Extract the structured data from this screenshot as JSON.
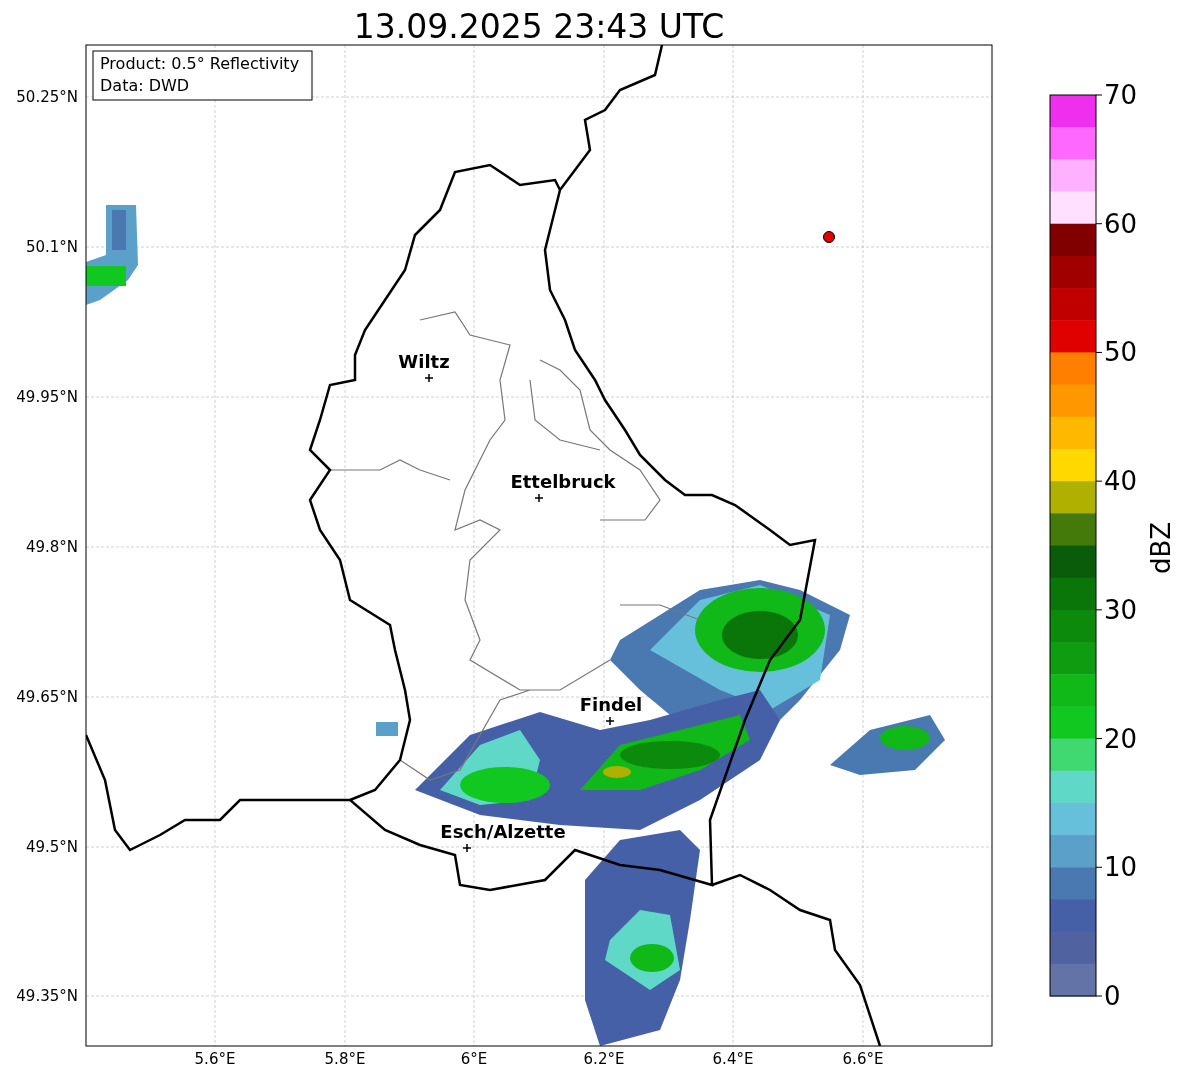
{
  "title": "13.09.2025 23:43 UTC",
  "legend": [
    "Product: 0.5° Reflectivity",
    "Data: DWD"
  ],
  "map": {
    "lat_labels": [
      "50.25°N",
      "50.1°N",
      "49.95°N",
      "49.8°N",
      "49.65°N",
      "49.5°N",
      "49.35°N"
    ],
    "lon_labels": [
      "5.6°E",
      "5.8°E",
      "6°E",
      "6.2°E",
      "6.4°E",
      "6.6°E"
    ],
    "places": [
      {
        "name": "Wiltz"
      },
      {
        "name": "Ettelbruck"
      },
      {
        "name": "Findel"
      },
      {
        "name": "Esch/Alzette"
      }
    ]
  },
  "colorbar": {
    "label": "dBZ",
    "ticks": [
      "70",
      "60",
      "50",
      "40",
      "30",
      "20",
      "10",
      "0"
    ],
    "bins": [
      {
        "color": "#ee30ee"
      },
      {
        "color": "#ff68ff"
      },
      {
        "color": "#ffb0ff"
      },
      {
        "color": "#ffe0ff"
      },
      {
        "color": "#800000"
      },
      {
        "color": "#a00000"
      },
      {
        "color": "#c00000"
      },
      {
        "color": "#e00000"
      },
      {
        "color": "#ff8000"
      },
      {
        "color": "#ff9800"
      },
      {
        "color": "#ffb800"
      },
      {
        "color": "#ffd800"
      },
      {
        "color": "#b0b000"
      },
      {
        "color": "#447a0a"
      },
      {
        "color": "#0a5c0a"
      },
      {
        "color": "#0a760a"
      },
      {
        "color": "#0c8a0c"
      },
      {
        "color": "#109c10"
      },
      {
        "color": "#10b818"
      },
      {
        "color": "#10c820"
      },
      {
        "color": "#40d870"
      },
      {
        "color": "#60d8c8"
      },
      {
        "color": "#66c0dc"
      },
      {
        "color": "#5aa0c8"
      },
      {
        "color": "#4a78b0"
      },
      {
        "color": "#4660a8"
      },
      {
        "color": "#5063a0"
      },
      {
        "color": "#6373a8"
      }
    ]
  }
}
